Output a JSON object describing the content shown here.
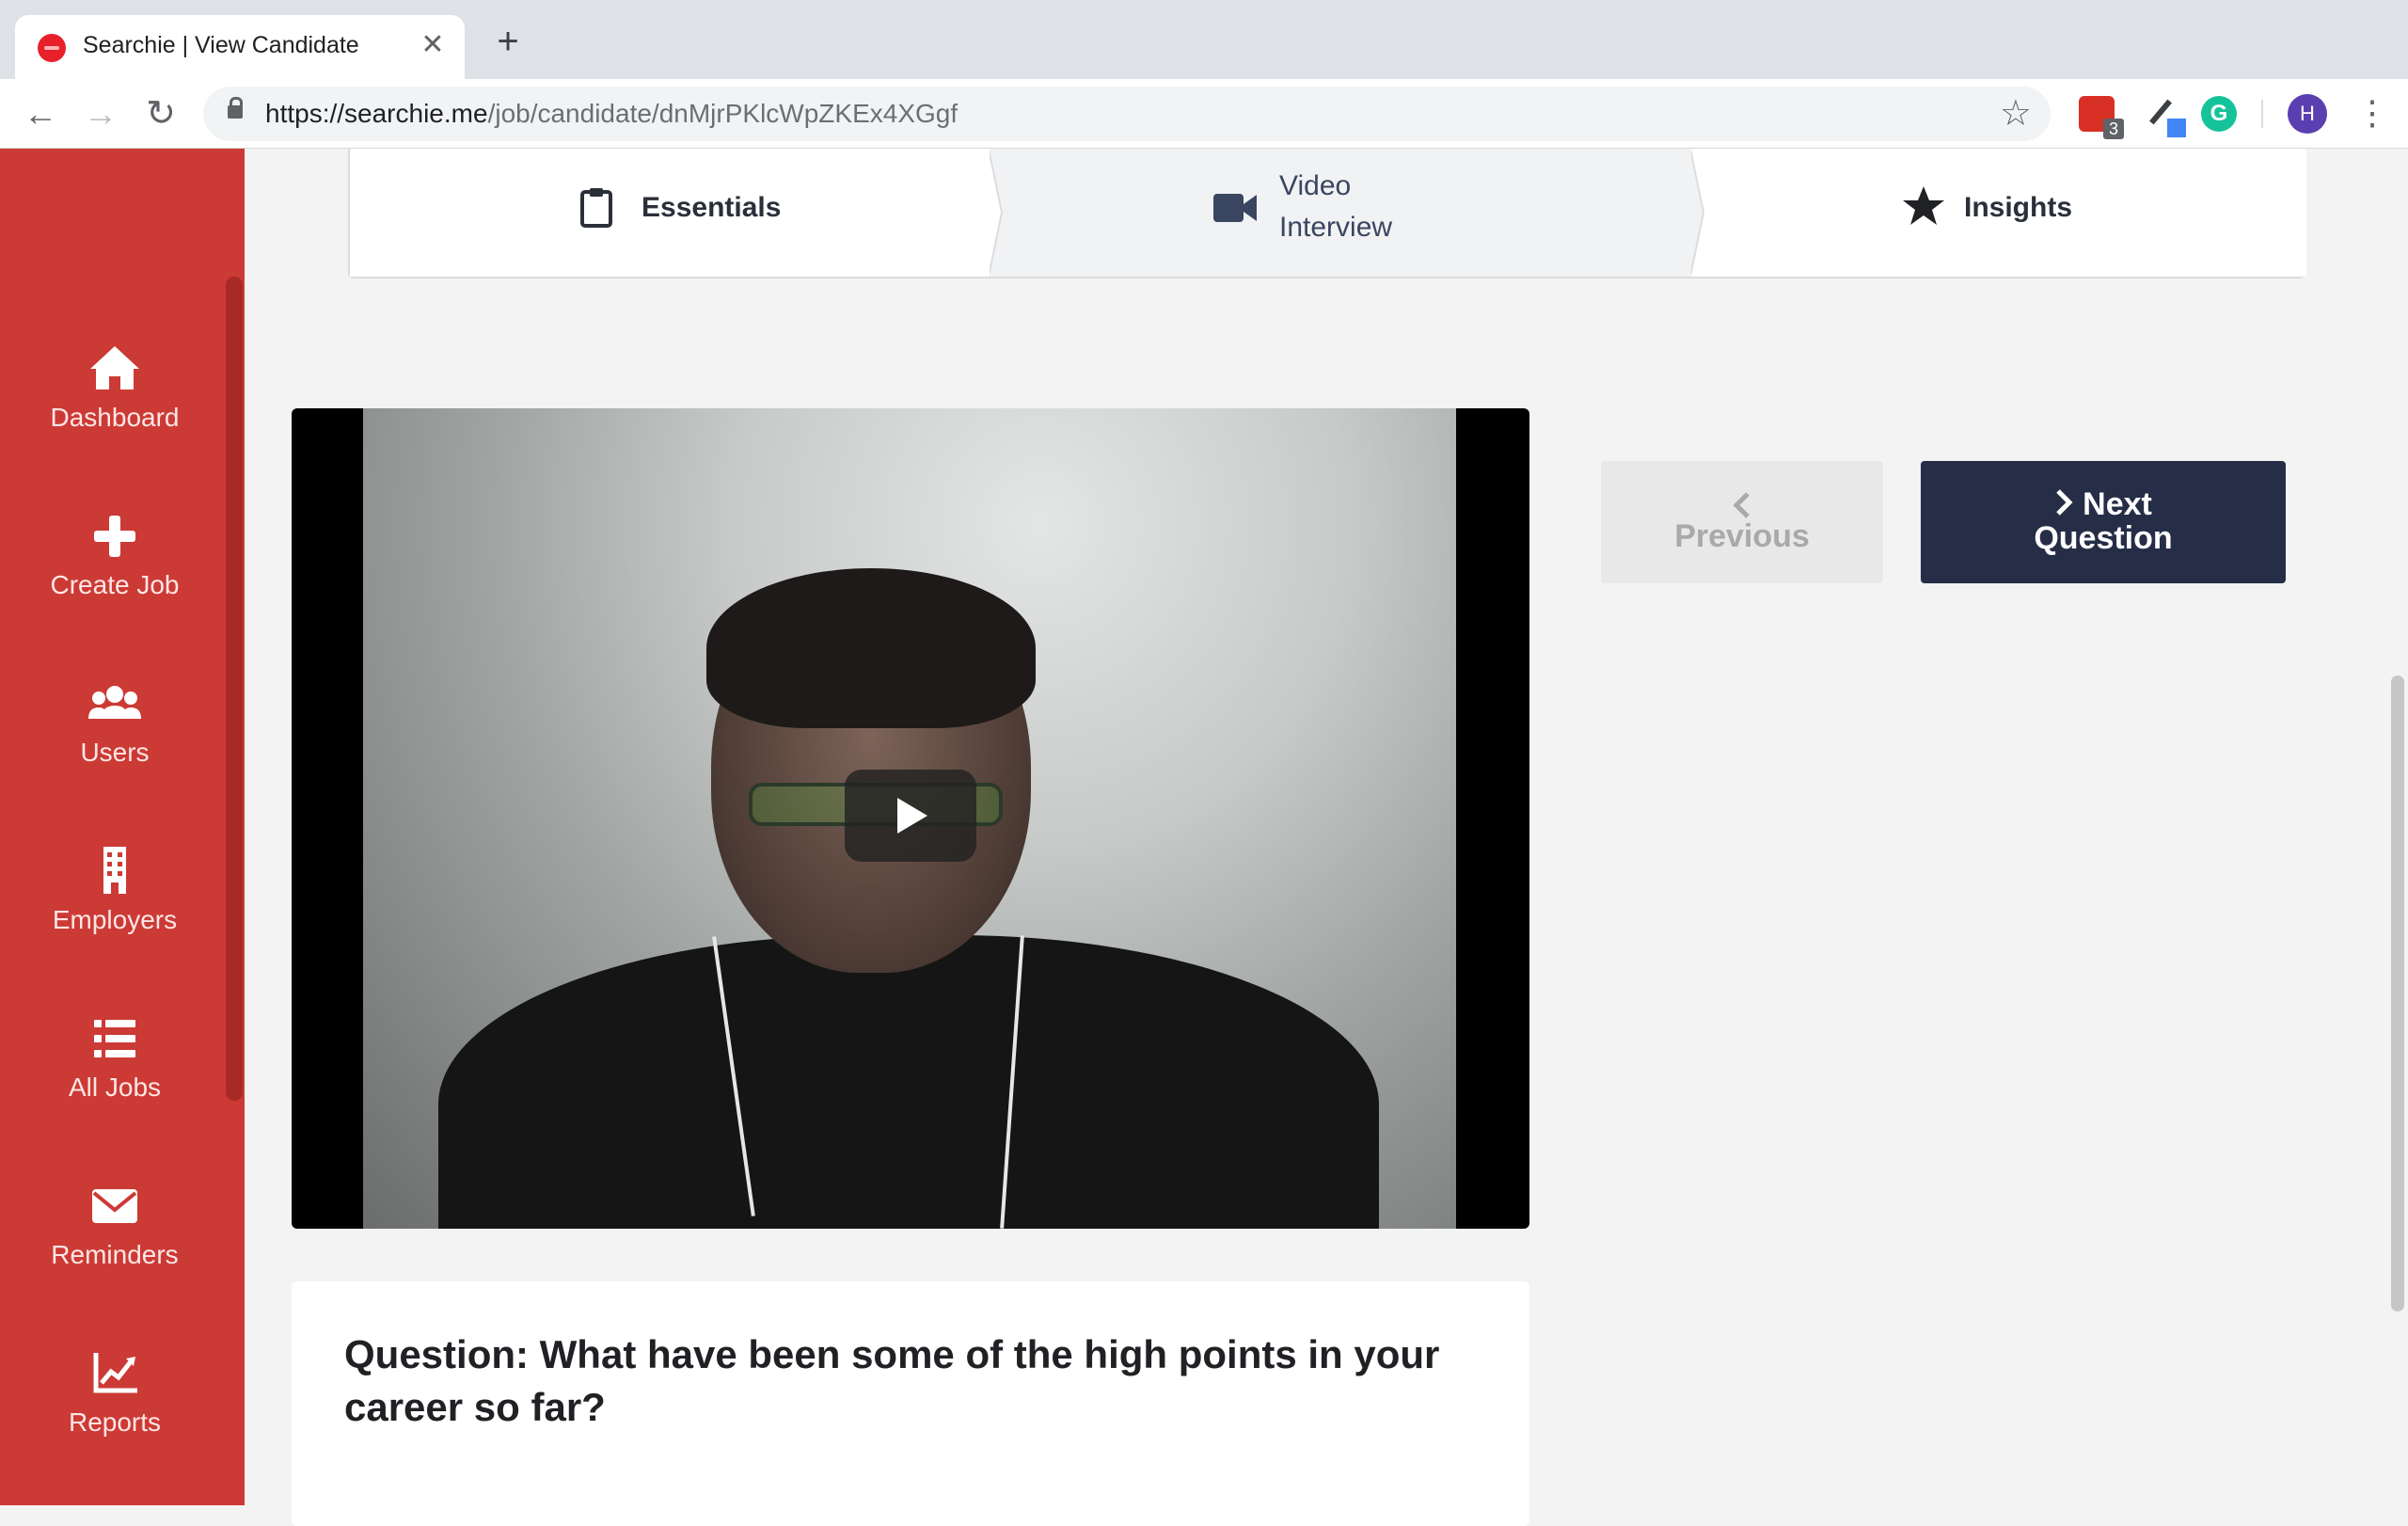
{
  "browser": {
    "tab_title": "Searchie | View Candidate",
    "tab_close": "✕",
    "new_tab": "+",
    "url_host": "https://searchie.me",
    "url_path": "/job/candidate/dnMjrPKlcWpZKEx4XGgf",
    "extension_badge": "3",
    "profile_initial": "H"
  },
  "sidebar": {
    "items": [
      {
        "label": "Dashboard",
        "icon": "home-icon"
      },
      {
        "label": "Create Job",
        "icon": "plus-icon"
      },
      {
        "label": "Users",
        "icon": "users-icon"
      },
      {
        "label": "Employers",
        "icon": "building-icon"
      },
      {
        "label": "All Jobs",
        "icon": "list-icon"
      },
      {
        "label": "Reminders",
        "icon": "envelope-icon"
      },
      {
        "label": "Reports",
        "icon": "chart-icon"
      }
    ]
  },
  "steps": {
    "essentials": "Essentials",
    "video_line1": "Video",
    "video_line2": "Interview",
    "insights": "Insights"
  },
  "nav": {
    "previous": "Previous",
    "next_line1": "Next",
    "next_line2": "Question"
  },
  "question": {
    "text": "Question: What have been some of the high points in your career so far?"
  },
  "colors": {
    "sidebar": "#cc3a35",
    "next_button": "#252d47",
    "accent_red": "#e8202a"
  }
}
